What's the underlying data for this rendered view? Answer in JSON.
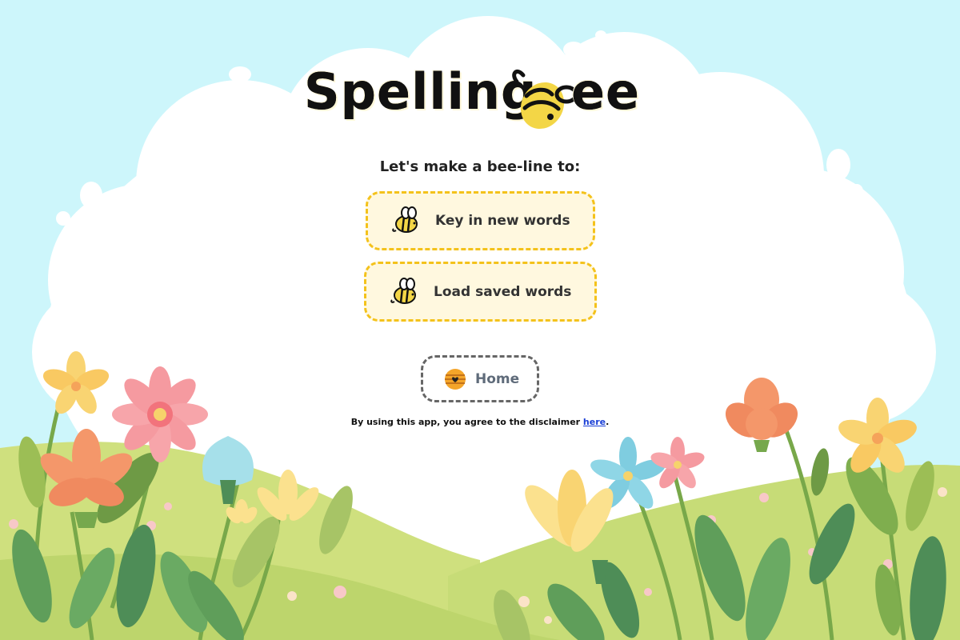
{
  "app": {
    "title_left": "Spelling",
    "title_right": "ee",
    "logo_icon": "bee-icon"
  },
  "prompt": "Let's make a bee-line to:",
  "actions": [
    {
      "label": "Key in new words",
      "icon": "bee-icon"
    },
    {
      "label": "Load saved words",
      "icon": "bee-icon"
    }
  ],
  "home": {
    "label": "Home",
    "icon": "beehive-icon"
  },
  "disclaimer": {
    "text": "By using this app, you agree to the disclaimer ",
    "link": "here",
    "end": "."
  },
  "colors": {
    "sky": "#cdf6fb",
    "cloud": "#ffffff",
    "accent_yellow": "#f4c21b",
    "button_bg": "#fff8df",
    "grass_light": "#cfe07e",
    "grass_dark": "#a9c95c",
    "link": "#1a3fd6"
  }
}
